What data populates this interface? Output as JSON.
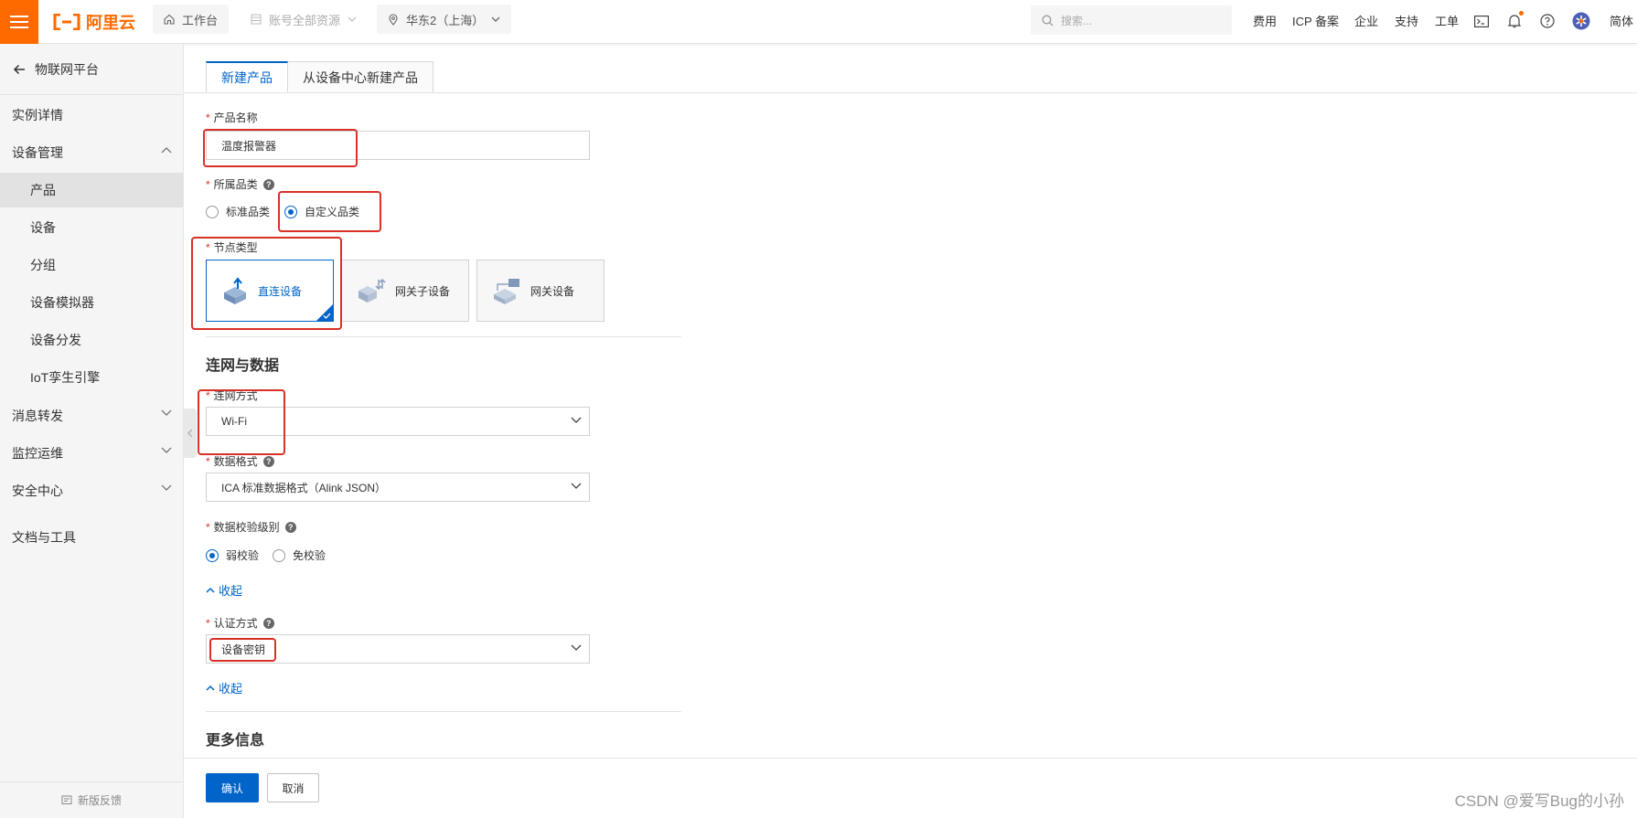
{
  "topbar": {
    "menu_icon": "hamburger-icon",
    "logo_text": "阿里云",
    "workbench": "工作台",
    "resources": "账号全部资源",
    "region": "华东2（上海）",
    "search_placeholder": "搜索...",
    "links": [
      "费用",
      "ICP 备案",
      "企业",
      "支持",
      "工单"
    ],
    "language": "简体",
    "brand_color": "#ff6a00"
  },
  "sidebar": {
    "back_label": "物联网平台",
    "items": [
      {
        "label": "实例详情"
      },
      {
        "label": "设备管理"
      },
      {
        "label": "产品"
      },
      {
        "label": "设备"
      },
      {
        "label": "分组"
      },
      {
        "label": "设备模拟器"
      },
      {
        "label": "设备分发"
      },
      {
        "label": "IoT孪生引擎"
      },
      {
        "label": "消息转发"
      },
      {
        "label": "监控运维"
      },
      {
        "label": "安全中心"
      },
      {
        "label": "文档与工具"
      }
    ],
    "active_item": "产品",
    "feedback": "新版反馈"
  },
  "tabs": [
    {
      "label": "新建产品",
      "active": true
    },
    {
      "label": "从设备中心新建产品",
      "active": false
    }
  ],
  "form": {
    "product_name": {
      "label": "产品名称",
      "value": "温度报警器"
    },
    "category": {
      "label": "所属品类",
      "options": [
        "标准品类",
        "自定义品类"
      ],
      "selected": "自定义品类"
    },
    "node_type": {
      "label": "节点类型",
      "options": [
        "直连设备",
        "网关子设备",
        "网关设备"
      ],
      "selected": "直连设备"
    },
    "network_section": "连网与数据",
    "network": {
      "label": "连网方式",
      "value": "Wi-Fi"
    },
    "data_format": {
      "label": "数据格式",
      "value": "ICA 标准数据格式（Alink JSON）"
    },
    "check_level": {
      "label": "数据校验级别",
      "options": [
        "弱校验",
        "免校验"
      ],
      "selected": "弱校验"
    },
    "collapse_label": "收起",
    "auth": {
      "label": "认证方式",
      "value": "设备密钥"
    },
    "more_section": "更多信息",
    "required_mark": "*",
    "help_mark": "?"
  },
  "footer": {
    "confirm": "确认",
    "cancel": "取消"
  },
  "watermark": "CSDN @爱写Bug的小孙",
  "colors": {
    "primary": "#0064c8",
    "annotation": "#d93026"
  }
}
